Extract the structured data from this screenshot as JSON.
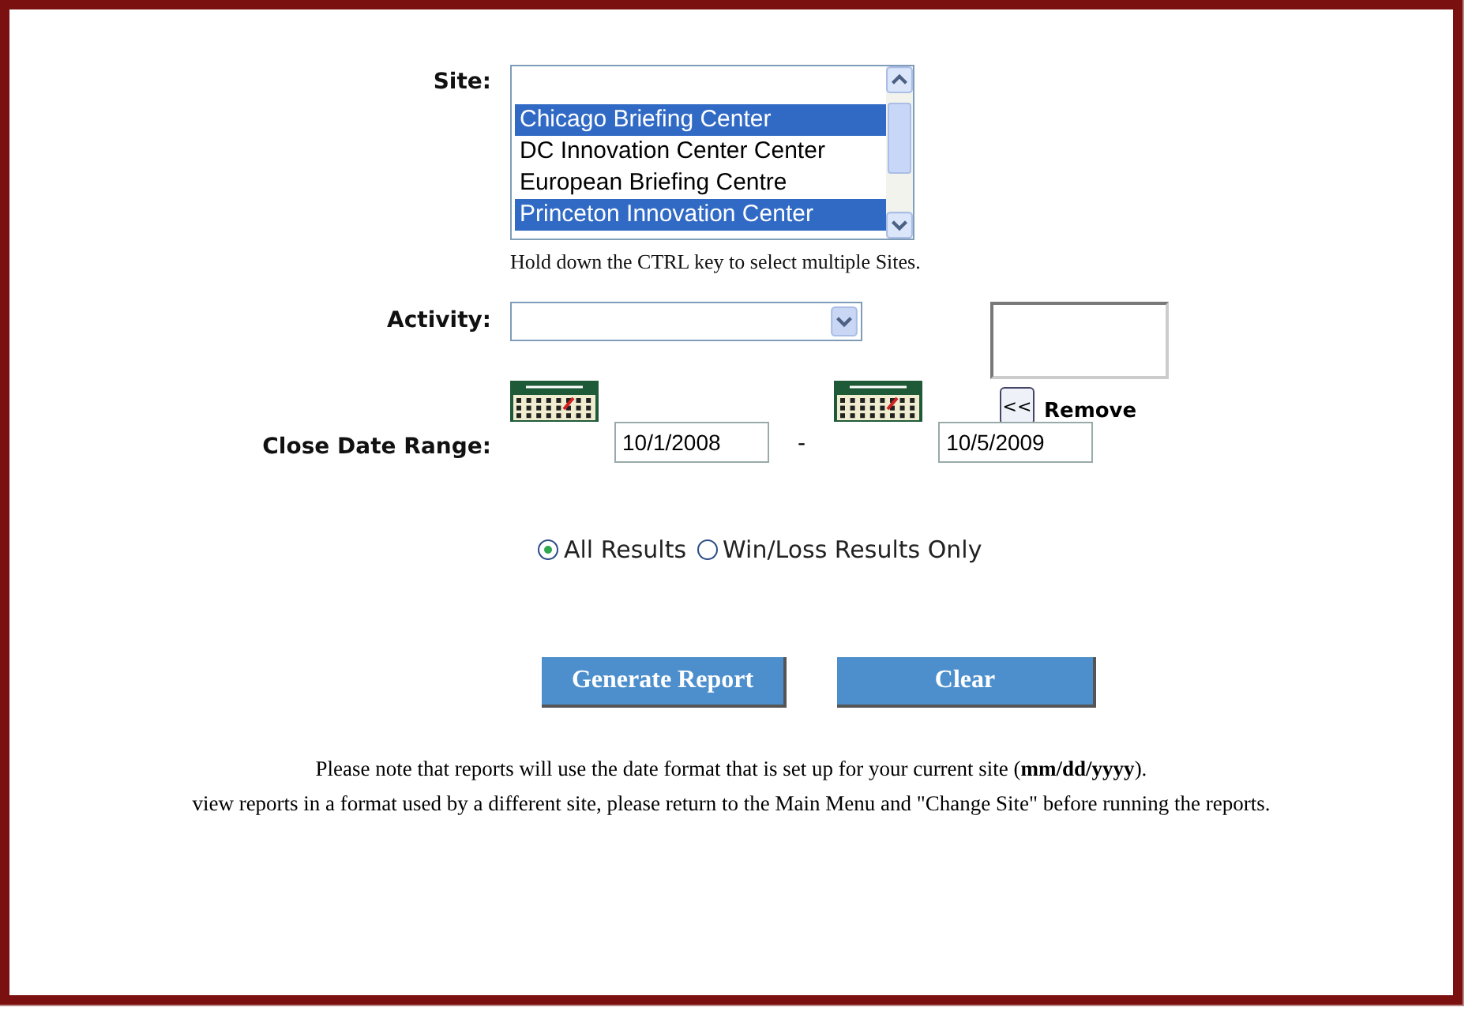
{
  "site": {
    "label": "Site:",
    "options": [
      {
        "label": "Chicago Briefing Center",
        "selected": true
      },
      {
        "label": "DC Innovation Center Center",
        "selected": false
      },
      {
        "label": "European Briefing Centre",
        "selected": false
      },
      {
        "label": "Princeton Innovation Center",
        "selected": true
      }
    ],
    "hint": "Hold down the CTRL key to select multiple Sites."
  },
  "activity": {
    "label": "Activity:",
    "remove_button": "<<",
    "remove_label": "Remove"
  },
  "date_range": {
    "label": "Close Date Range:",
    "start": "10/1/2008",
    "separator": "-",
    "end": "10/5/2009"
  },
  "results": [
    {
      "label": "All Results",
      "selected": true
    },
    {
      "label": "Win/Loss Results Only",
      "selected": false
    }
  ],
  "buttons": [
    "Generate Report",
    "Clear"
  ],
  "notes": [
    "Please note that reports will use the date format that is set up for your current site (**mm/dd/yyyy**).",
    "view reports in a format used by a different site, please return to the Main Menu and \"Change Site\" before running the reports."
  ]
}
